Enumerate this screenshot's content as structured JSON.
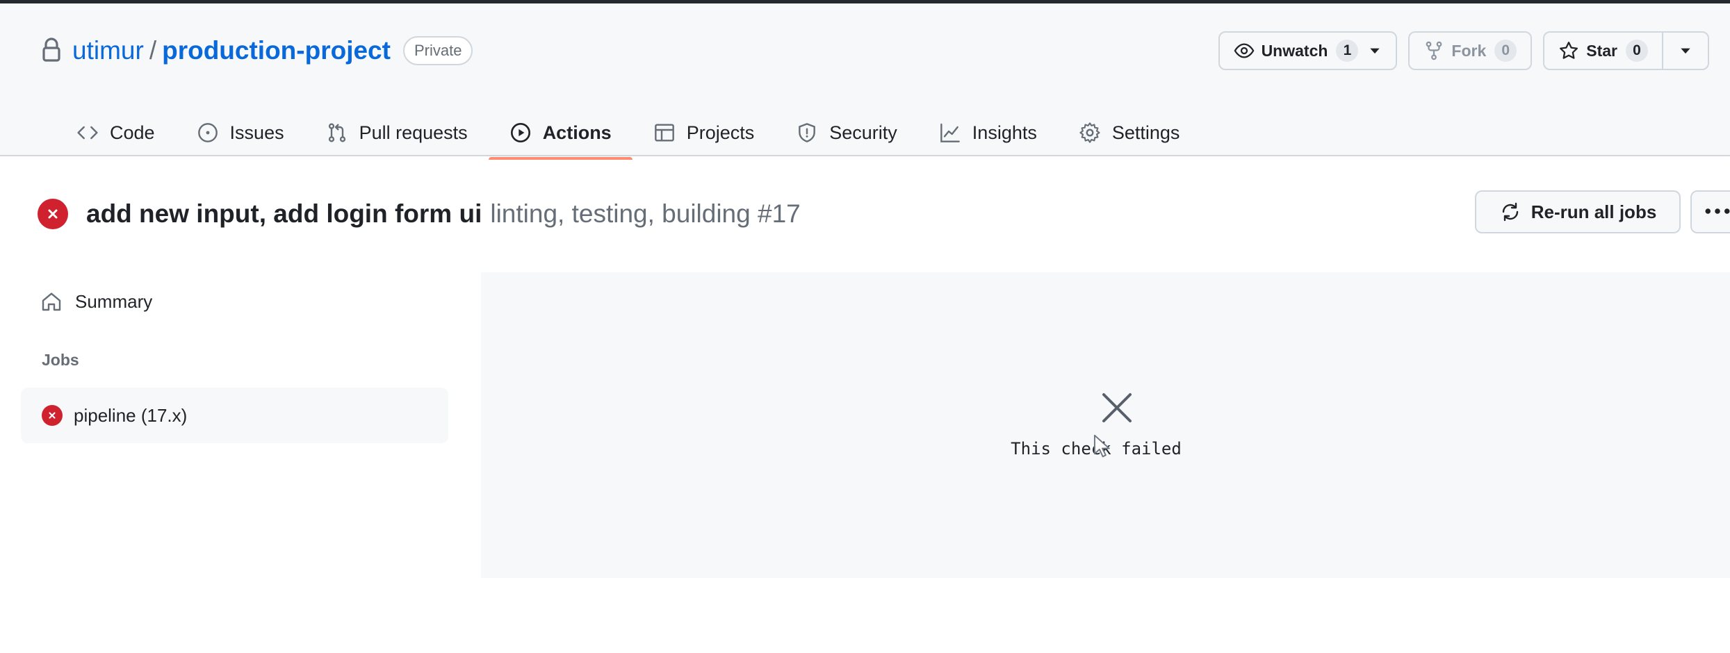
{
  "repo": {
    "owner": "utimur",
    "separator": "/",
    "name": "production-project",
    "visibility": "Private"
  },
  "header_actions": {
    "unwatch": {
      "label": "Unwatch",
      "count": "1"
    },
    "fork": {
      "label": "Fork",
      "count": "0"
    },
    "star": {
      "label": "Star",
      "count": "0"
    }
  },
  "tabs": [
    {
      "label": "Code",
      "icon": "code-icon"
    },
    {
      "label": "Issues",
      "icon": "issue-opened-icon"
    },
    {
      "label": "Pull requests",
      "icon": "git-pull-request-icon"
    },
    {
      "label": "Actions",
      "icon": "play-icon",
      "active": true
    },
    {
      "label": "Projects",
      "icon": "table-icon"
    },
    {
      "label": "Security",
      "icon": "shield-icon"
    },
    {
      "label": "Insights",
      "icon": "graph-icon"
    },
    {
      "label": "Settings",
      "icon": "gear-icon"
    }
  ],
  "run": {
    "title": "add new input, add login form ui",
    "workflow": "linting, testing, building #17",
    "status": "failed",
    "rerun_label": "Re-run all jobs"
  },
  "sidebar": {
    "summary_label": "Summary",
    "jobs_heading": "Jobs",
    "jobs": [
      {
        "label": "pipeline (17.x)",
        "status": "failed"
      }
    ]
  },
  "panel": {
    "message": "This check failed"
  },
  "colors": {
    "accent_link": "#0969da",
    "failure_red": "#cf222e",
    "active_tab_underline": "#fd8c73",
    "header_bg": "#f6f8fa"
  }
}
